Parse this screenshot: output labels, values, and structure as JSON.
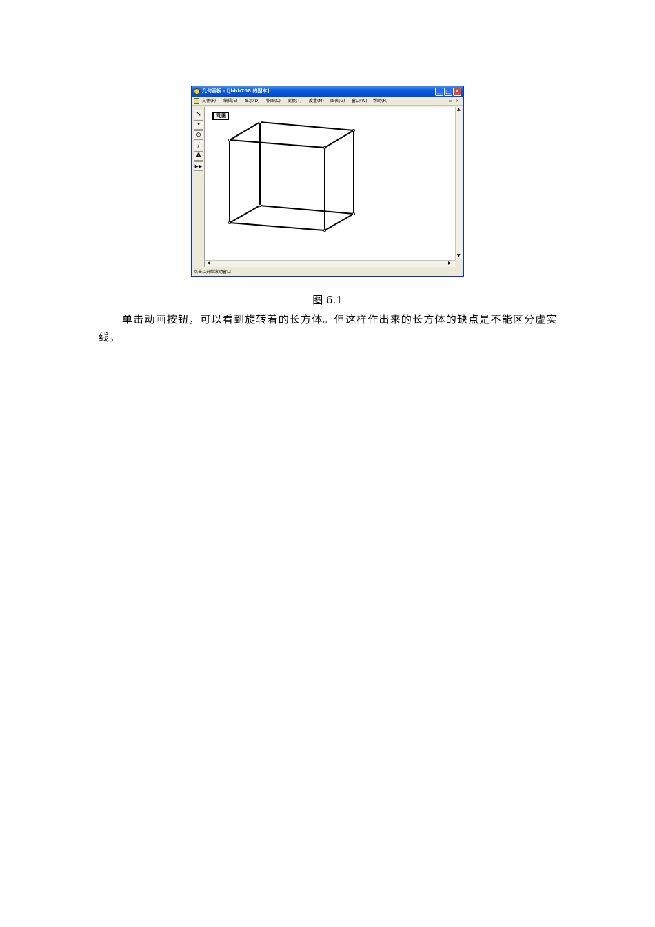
{
  "window": {
    "title": "几何画板 - [jhhh708 的副本]",
    "controls": {
      "minimize": "▁",
      "maximize": "□",
      "close": "✕"
    },
    "menu": [
      "文件(F)",
      "编辑(E)",
      "显示(D)",
      "作图(C)",
      "变换(T)",
      "度量(M)",
      "图表(G)",
      "窗口(W)",
      "帮助(H)"
    ],
    "mdi_controls": [
      "–",
      "▫",
      "×"
    ],
    "tools": [
      "➘",
      "•",
      "⊙",
      "∕",
      "A",
      "▶▶"
    ],
    "animation_button": "动画",
    "status": "点击以开始滚动窗口"
  },
  "caption": "图 6.1",
  "paragraph": "单击动画按钮，可以看到旋转着的长方体。但这样作出来的长方体的缺点是不能区分虚实线。"
}
